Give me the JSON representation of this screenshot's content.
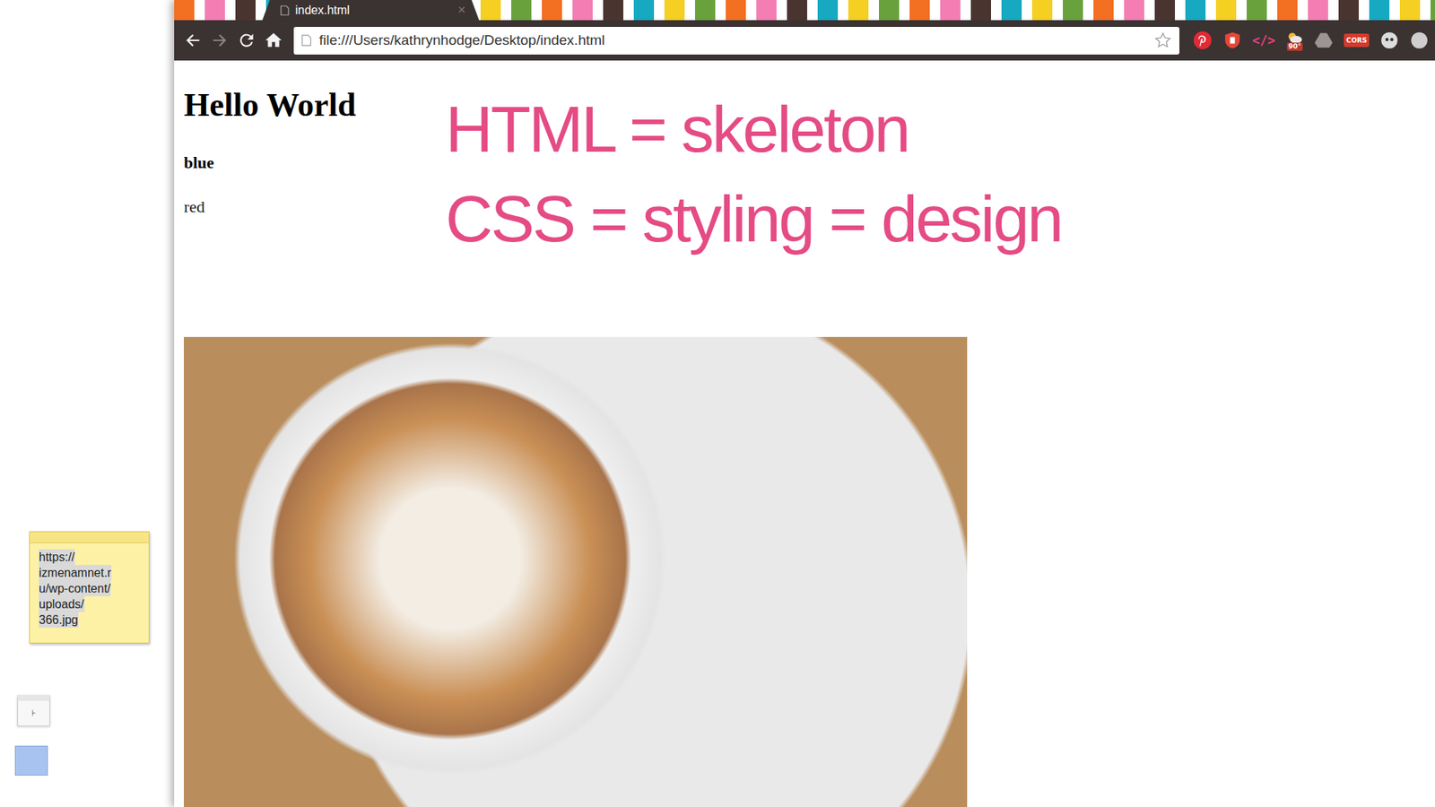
{
  "browser": {
    "tab": {
      "title": "index.html",
      "close": "×",
      "selected": true
    },
    "url": "file:///Users/kathrynhodge/Desktop/index.html",
    "extension_labels": {
      "code": "</>",
      "weather": "90°",
      "cors": "CORS"
    }
  },
  "page": {
    "heading": "Hello World",
    "lines": [
      {
        "text": "blue",
        "bold": true
      },
      {
        "text": "red",
        "bold": false
      }
    ]
  },
  "annotation": {
    "lines": [
      "HTML = skeleton",
      "CSS = styling = design"
    ]
  },
  "desktop": {
    "sticky_note": {
      "lines": [
        "https://",
        "izmenamnet.r",
        "u/wp-content/",
        "uploads/",
        "366.jpg"
      ],
      "selected": true
    },
    "widget": {
      "label": "⊦"
    }
  }
}
